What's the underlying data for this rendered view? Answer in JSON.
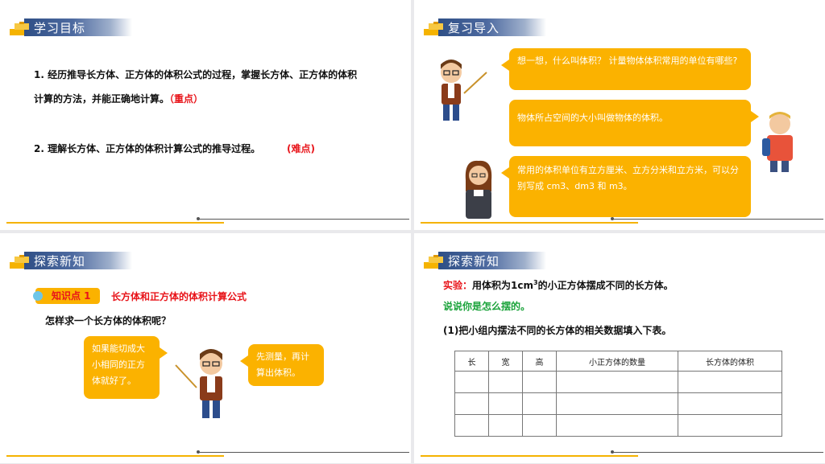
{
  "slides": [
    {
      "header": "学习目标",
      "goal1": "1.  经历推导长方体、正方体的体积公式的过程，掌握长方体、正方体的体积",
      "goal1_cont": "计算的方法，并能正确地计算。",
      "goal1_tag": "（重点）",
      "goal2": "2.  理解长方体、正方体的体积计算公式的推导过程。",
      "goal2_tag": "(难点)"
    },
    {
      "header": "复习导入",
      "bubble1": "想一想，什么叫体积？ 计量物体体积常用的单位有哪些?",
      "bubble2": "物体所占空间的大小叫做物体的体积。",
      "bubble3": "常用的体积单位有立方厘米、立方分米和立方米，可以分别写成 cm3、dm3 和 m3。"
    },
    {
      "header": "探索新知",
      "badge": "知识点 1",
      "topic": "长方体和正方体的体积计算公式",
      "question": "怎样求一个长方体的体积呢？",
      "bubble_left": "如果能切成大小相同的正方体就好了。",
      "bubble_right": "先测量，再计算出体积。"
    },
    {
      "header": "探索新知",
      "exp_label": "实验：",
      "exp_text_a": "用体积为1cm",
      "exp_text_sup": "3",
      "exp_text_b": "的小正方体摆成不同的长方体。",
      "discuss": "说说你是怎么摆的。",
      "task": "(1)把小组内摆法不同的长方体的相关数据填入下表。",
      "table_headers": [
        "长",
        "宽",
        "高",
        "小正方体的数量",
        "长方体的体积"
      ]
    }
  ],
  "colors": {
    "accent": "#fbb200",
    "header_blue": "#2f4f86",
    "emphasis_red": "#e8141a",
    "green": "#1aa33a"
  }
}
